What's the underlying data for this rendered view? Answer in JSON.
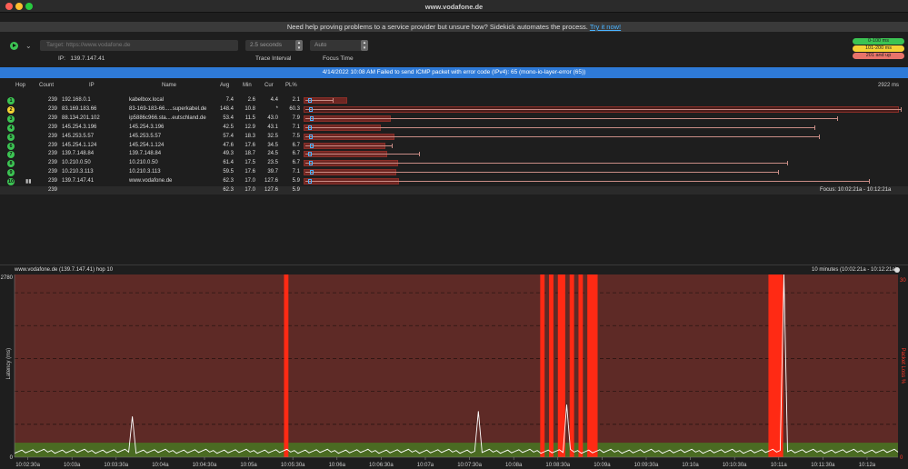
{
  "window": {
    "title": "www.vodafone.de"
  },
  "banner": {
    "text": "Need help proving problems to a service provider but unsure how? Sidekick automates the process.",
    "link": "Try it now!"
  },
  "toolbar": {
    "target_placeholder": "Target:   https://www.vodafone.de",
    "ip_label": "IP:",
    "ip_value": "139.7.147.41",
    "interval_value": "2.5 seconds",
    "interval_label": "Trace Interval",
    "focus_value": "Auto",
    "focus_label": "Focus Time"
  },
  "legend": [
    {
      "label": "0-100 ms",
      "color": "#3cc453"
    },
    {
      "label": "101-200 ms",
      "color": "#f5d234"
    },
    {
      "label": "201 and up",
      "color": "#e8736a"
    }
  ],
  "error_bar": "4/14/2022 10:08 AM Failed to send ICMP packet with error code (IPv4): 65 (mono-io-layer-error (65))",
  "table": {
    "headers": {
      "hop": "Hop",
      "count": "Count",
      "ip": "IP",
      "name": "Name",
      "avg": "Avg",
      "min": "Min",
      "cur": "Cur",
      "pl": "PL%"
    },
    "max_label": "2922 ms",
    "rows": [
      {
        "hop": "1",
        "count": "239",
        "ip": "192.168.0.1",
        "name": "kabelbox.local",
        "avg": "7.4",
        "min": "2.6",
        "cur": "4.4",
        "pl": "2.1",
        "color": "#3cc453"
      },
      {
        "hop": "2",
        "count": "239",
        "ip": "83.169.183.66",
        "name": "83-169-183-66.....superkabel.de",
        "avg": "148.4",
        "min": "10.8",
        "cur": "*",
        "pl": "60.3",
        "color": "#f5d234"
      },
      {
        "hop": "3",
        "count": "239",
        "ip": "88.134.201.102",
        "name": "ip5886c966.sta....eutschland.de",
        "avg": "53.4",
        "min": "11.5",
        "cur": "43.0",
        "pl": "7.9",
        "color": "#3cc453"
      },
      {
        "hop": "4",
        "count": "239",
        "ip": "145.254.3.196",
        "name": "145.254.3.196",
        "avg": "42.5",
        "min": "12.9",
        "cur": "43.1",
        "pl": "7.1",
        "color": "#3cc453"
      },
      {
        "hop": "5",
        "count": "239",
        "ip": "145.253.5.57",
        "name": "145.253.5.57",
        "avg": "57.4",
        "min": "18.3",
        "cur": "32.5",
        "pl": "7.5",
        "color": "#3cc453"
      },
      {
        "hop": "6",
        "count": "239",
        "ip": "145.254.1.124",
        "name": "145.254.1.124",
        "avg": "47.6",
        "min": "17.6",
        "cur": "34.5",
        "pl": "6.7",
        "color": "#3cc453"
      },
      {
        "hop": "7",
        "count": "239",
        "ip": "139.7.148.84",
        "name": "139.7.148.84",
        "avg": "49.3",
        "min": "18.7",
        "cur": "24.5",
        "pl": "6.7",
        "color": "#3cc453"
      },
      {
        "hop": "8",
        "count": "239",
        "ip": "10.210.0.50",
        "name": "10.210.0.50",
        "avg": "61.4",
        "min": "17.5",
        "cur": "23.5",
        "pl": "6.7",
        "color": "#3cc453"
      },
      {
        "hop": "9",
        "count": "239",
        "ip": "10.210.3.113",
        "name": "10.210.3.113",
        "avg": "59.5",
        "min": "17.6",
        "cur": "39.7",
        "pl": "7.1",
        "color": "#3cc453"
      },
      {
        "hop": "10",
        "count": "239",
        "ip": "139.7.147.41",
        "name": "www.vodafone.de",
        "avg": "62.3",
        "min": "17.0",
        "cur": "127.6",
        "pl": "5.9",
        "color": "#3cc453"
      }
    ],
    "summary": {
      "count": "239",
      "avg": "62.3",
      "min": "17.0",
      "cur": "127.6",
      "pl": "5.9",
      "focus": "Focus: 10:02:21a - 10:12:21a"
    }
  },
  "chart_data": {
    "type": "line",
    "title": "www.vodafone.de (139.7.147.41) hop 10",
    "range_label": "10 minutes (10:02:21a - 10:12:21a)",
    "ylabel": "Latency (ms)",
    "y2label": "Packet Loss %",
    "ylim": [
      0,
      2780
    ],
    "y_ticks": [
      "2780",
      "0"
    ],
    "y2_ticks": [
      "30",
      "0"
    ],
    "x_ticks": [
      "10:02:30a",
      "10:03a",
      "10:03:30a",
      "10:04a",
      "10:04:30a",
      "10:05a",
      "10:05:30a",
      "10:06a",
      "10:06:30a",
      "10:07a",
      "10:07:30a",
      "10:08a",
      "10:08:30a",
      "10:09a",
      "10:09:30a",
      "10:10a",
      "10:10:30a",
      "10:11a",
      "10:11:30a",
      "10:12a"
    ],
    "loss_bands": [
      {
        "start": "10:05:24a",
        "end": "10:05:27a"
      },
      {
        "start": "10:08:18a",
        "end": "10:08:21a"
      },
      {
        "start": "10:08:24a",
        "end": "10:08:27a"
      },
      {
        "start": "10:08:30a",
        "end": "10:08:35a"
      },
      {
        "start": "10:08:38a",
        "end": "10:08:41a"
      },
      {
        "start": "10:08:44a",
        "end": "10:08:47a"
      },
      {
        "start": "10:08:50a",
        "end": "10:08:57a"
      },
      {
        "start": "10:10:53a",
        "end": "10:11:03a"
      }
    ],
    "latency_spikes": [
      {
        "x": "10:03:40a",
        "y": 620
      },
      {
        "x": "10:07:35a",
        "y": 700
      },
      {
        "x": "10:08:35a",
        "y": 800
      },
      {
        "x": "10:11:04a",
        "y": 2780
      }
    ],
    "baseline_ms": 60,
    "colors": {
      "loss": "#ff2a14",
      "plot_bg": "#5e2a26",
      "ok_band": "#4a6b22",
      "line": "#ffffff"
    }
  }
}
